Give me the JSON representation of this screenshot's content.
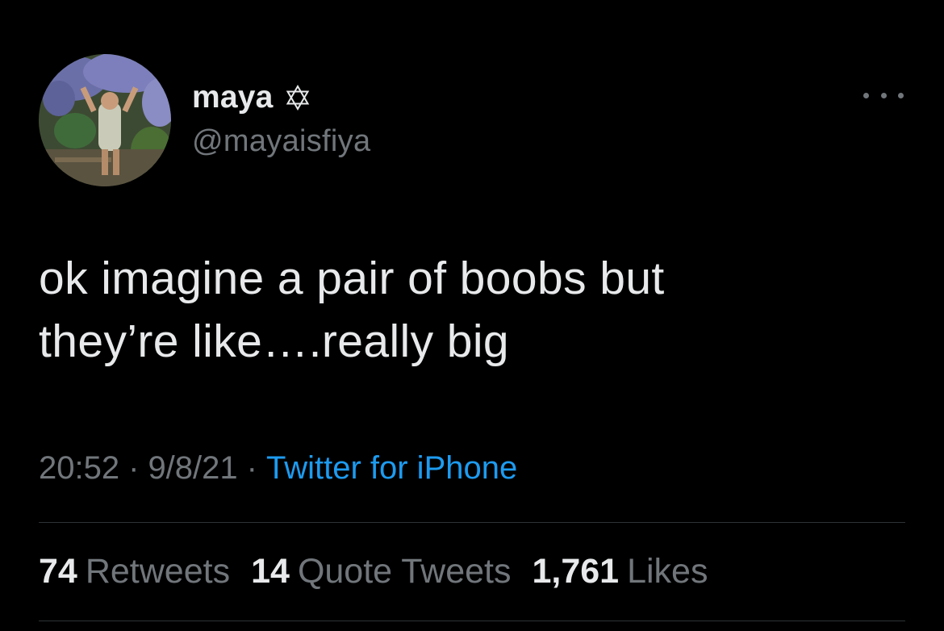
{
  "user": {
    "display_name": "maya",
    "handle": "@mayaisfiya",
    "badge_icon": "star-of-david-icon",
    "avatar": "profile-photo"
  },
  "tweet": {
    "text": "ok imagine a pair of boobs but\nthey’re like….really big",
    "time": "20:52",
    "date": "9/8/21",
    "separator": "·",
    "source": "Twitter for iPhone"
  },
  "stats": {
    "retweets_count": "74",
    "retweets_label": "Retweets",
    "quotes_count": "14",
    "quotes_label": "Quote Tweets",
    "likes_count": "1,761",
    "likes_label": "Likes"
  },
  "colors": {
    "background": "#000000",
    "primary_text": "#e7e9ea",
    "secondary_text": "#71767b",
    "link": "#1d9bf0",
    "divider": "#2f3336"
  },
  "icons": {
    "more": "more-options-icon"
  }
}
